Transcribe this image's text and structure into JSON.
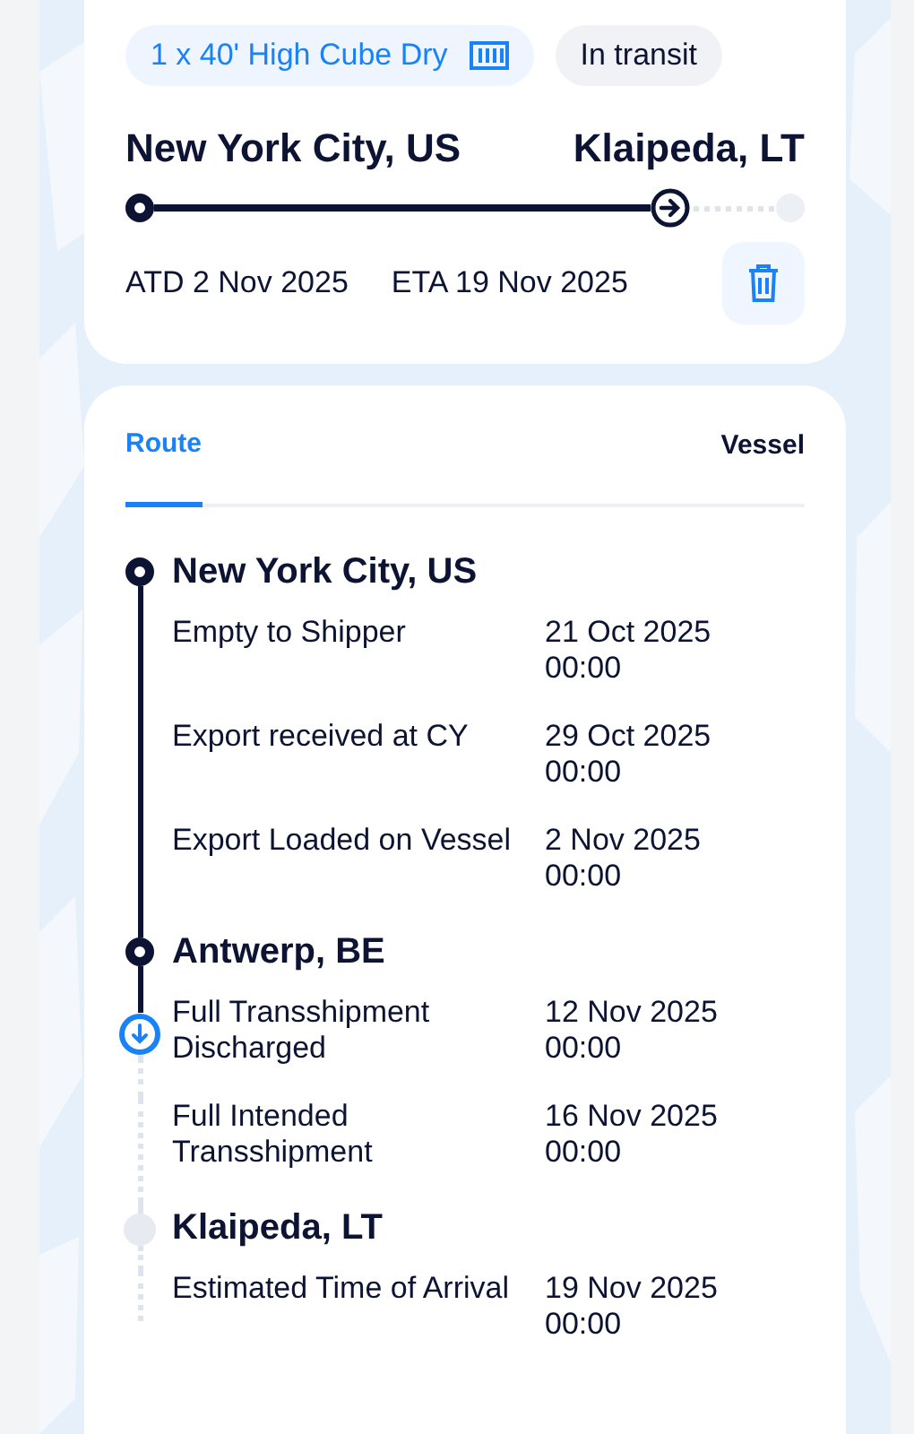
{
  "shipment": {
    "container": "1 x 40' High Cube Dry",
    "status": "In transit",
    "origin": "New York City, US",
    "destination": "Klaipeda, LT",
    "atd": "ATD 2 Nov 2025",
    "eta": "ETA 19 Nov 2025"
  },
  "tabs": [
    {
      "label": "Route",
      "selected": true
    },
    {
      "label": "Vessel",
      "selected": false
    }
  ],
  "route": [
    {
      "place": "New York City, US",
      "reached": true,
      "events": [
        {
          "label": "Empty to Shipper",
          "date": "21 Oct 2025 00:00",
          "current": false
        },
        {
          "label": "Export received at CY",
          "date": "29 Oct 2025 00:00",
          "current": false
        },
        {
          "label": "Export Loaded on Vessel",
          "date": "2 Nov 2025 00:00",
          "current": false
        }
      ]
    },
    {
      "place": "Antwerp, BE",
      "reached": true,
      "events": [
        {
          "label": "Full Transshipment Discharged",
          "date": "12 Nov 2025 00:00",
          "current": true
        },
        {
          "label": "Full Intended Transshipment",
          "date": "16 Nov 2025 00:00",
          "current": false
        }
      ]
    },
    {
      "place": "Klaipeda, LT",
      "reached": false,
      "events": [
        {
          "label": "Estimated Time of Arrival",
          "date": "19 Nov 2025 00:00",
          "current": false
        }
      ]
    }
  ]
}
